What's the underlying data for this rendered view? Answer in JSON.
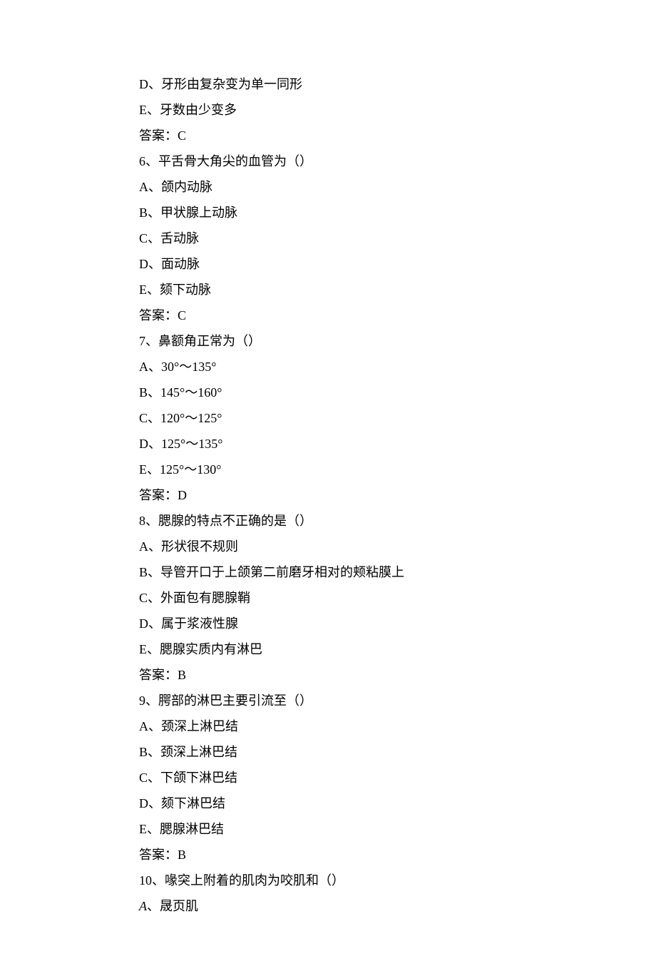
{
  "lines": [
    "D、牙形由复杂变为单一同形",
    "E、牙数由少变多",
    "答案：C",
    "6、平舌骨大角尖的血管为（）",
    "A、颌内动脉",
    "B、甲状腺上动脉",
    "C、舌动脉",
    "D、面动脉",
    "E、颏下动脉",
    "答案：C",
    "7、鼻额角正常为（）",
    "A、30°～135°",
    "B、145°～160°",
    "C、120°～125°",
    "D、125°～135°",
    "E、125°～130°",
    "答案：D",
    "8、腮腺的特点不正确的是（）",
    "A、形状很不规则",
    "B、导管开口于上颌第二前磨牙相对的颊粘膜上",
    "C、外面包有腮腺鞘",
    "D、属于浆液性腺",
    "E、腮腺实质内有淋巴",
    "答案：B",
    "9、腭部的淋巴主要引流至（）",
    "A、颈深上淋巴结",
    "B、颈深上淋巴结",
    "C、下颌下淋巴结",
    "D、颏下淋巴结",
    "E、腮腺淋巴结",
    "答案：B",
    "10、喙突上附着的肌肉为咬肌和（）"
  ],
  "last_line_prefix": "A",
  "last_line_rest": "、晟页肌"
}
